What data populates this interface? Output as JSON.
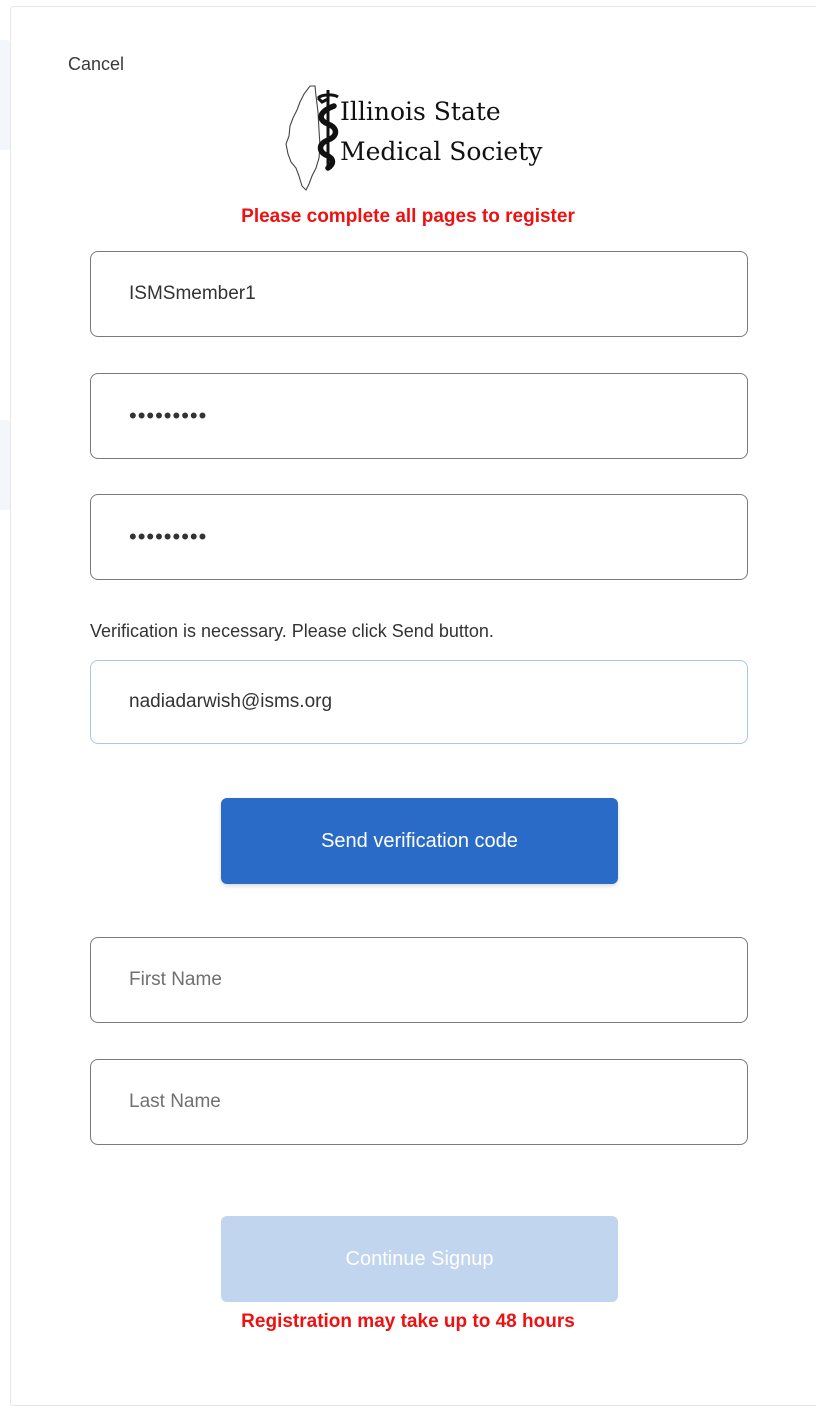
{
  "header": {
    "cancel_label": "Cancel",
    "logo": {
      "line1": "Illinois State",
      "line2": "Medical Society",
      "icon": "illinois-map-caduceus-icon"
    }
  },
  "notices": {
    "top": "Please complete all pages to register",
    "bottom": "Registration may take up to 48 hours",
    "color": "#ee1111"
  },
  "form": {
    "username": {
      "value": "ISMSmember1"
    },
    "password": {
      "value": "•••••••••"
    },
    "confirm_password": {
      "value": "•••••••••"
    },
    "verification_message": "Verification is necessary. Please click Send button.",
    "email": {
      "value": "nadiadarwish@isms.org"
    },
    "send_button_label": "Send verification code",
    "first_name": {
      "value": "",
      "placeholder": "First Name"
    },
    "last_name": {
      "value": "",
      "placeholder": "Last Name"
    },
    "continue_button_label": "Continue Signup"
  },
  "colors": {
    "primary": "#2a6bc7",
    "disabled": "#c1d5ef",
    "focus_border": "#a9c7ec"
  }
}
